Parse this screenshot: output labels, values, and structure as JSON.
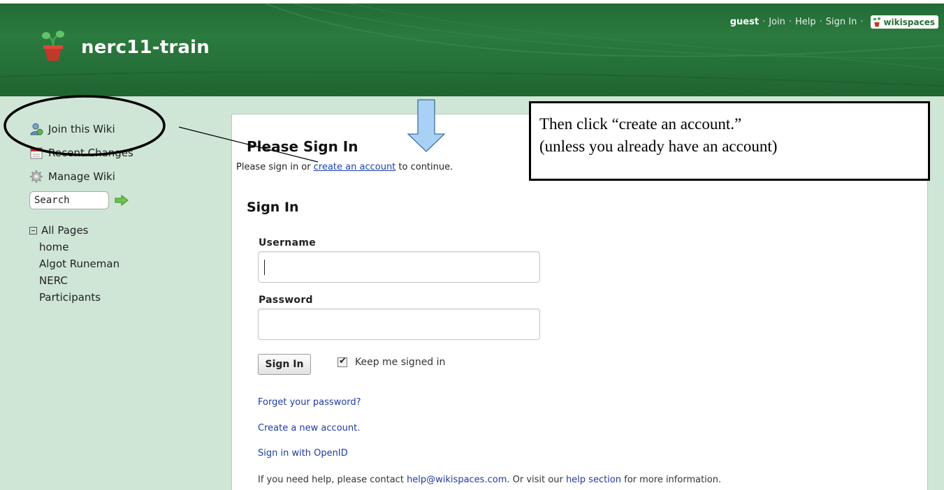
{
  "header": {
    "site_title": "nerc11-train",
    "user": "guest",
    "nav": {
      "join": "Join",
      "help": "Help",
      "sign_in": "Sign In"
    },
    "brand": "wikispaces",
    "colors": {
      "header_green": "#2b7a3f",
      "sidebar_bg": "#cfe6d6",
      "link_blue": "#1f3aa3"
    }
  },
  "sidebar": {
    "items": [
      {
        "label": "Join this Wiki",
        "icon": "user-add-icon"
      },
      {
        "label": "Recent Changes",
        "icon": "calendar-icon"
      },
      {
        "label": "Manage Wiki",
        "icon": "gear-icon"
      }
    ],
    "search": {
      "value": "Search"
    },
    "pages_header": "All Pages",
    "pages": [
      "home",
      "Algot Runeman",
      "NERC",
      "Participants"
    ]
  },
  "main": {
    "title": "Please Sign In",
    "subtitle_prefix": "Please sign in or ",
    "subtitle_link": "create an account",
    "subtitle_suffix": " to continue.",
    "section_title": "Sign In",
    "username_label": "Username",
    "password_label": "Password",
    "signin_button": "Sign In",
    "keep_signed_in": "Keep me signed in",
    "keep_checked": true,
    "forgot_link": "Forget your password?",
    "create_link": "Create a new account.",
    "openid_link": "Sign in with OpenID",
    "help_prefix": "If you need help, please contact ",
    "help_email": "help@wikispaces.com",
    "help_middle": ". Or visit our ",
    "help_section": "help section",
    "help_suffix": " for more information."
  },
  "annotation": {
    "line1": "Then click “create an account.”",
    "line2": "(unless you already have an account)"
  }
}
